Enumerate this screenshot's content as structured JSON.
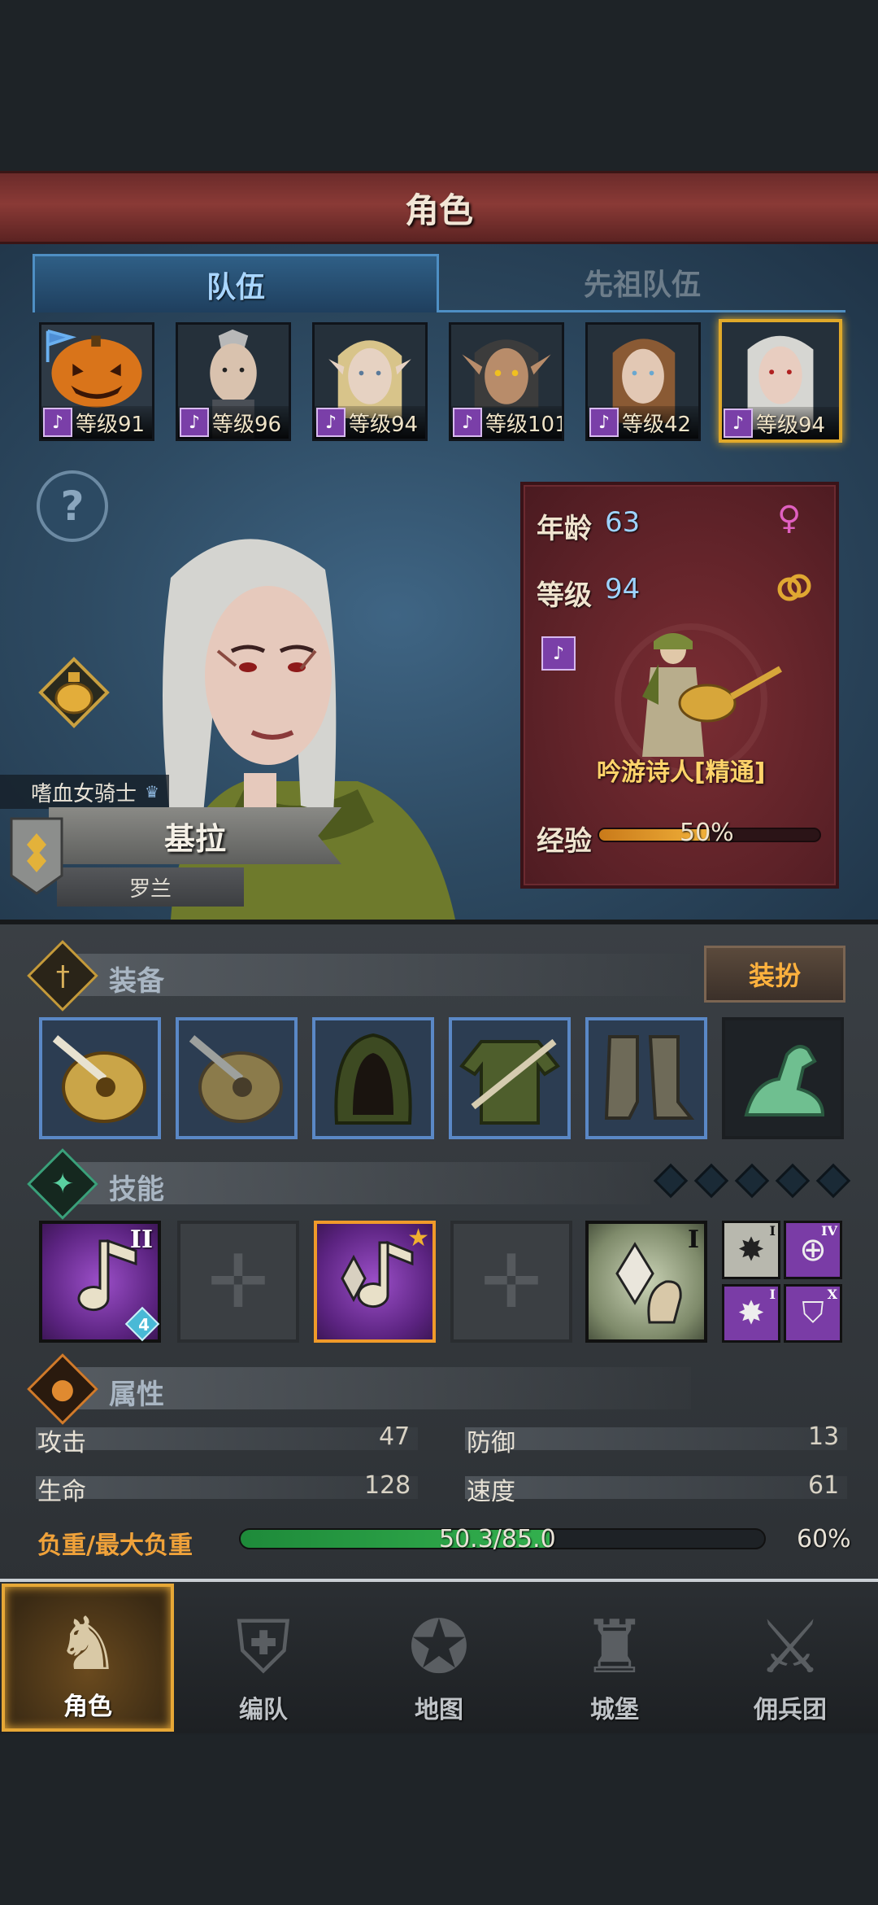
{
  "header": {
    "title": "角色"
  },
  "tabs": [
    {
      "label": "队伍",
      "active": true
    },
    {
      "label": "先祖队伍",
      "active": false
    }
  ],
  "party": [
    {
      "level": "等级91",
      "portrait": "pumpkin-head-icon"
    },
    {
      "level": "等级96",
      "portrait": "warrior-mohawk-icon"
    },
    {
      "level": "等级94",
      "portrait": "blonde-elf-icon"
    },
    {
      "level": "等级101",
      "portrait": "dark-elf-icon"
    },
    {
      "level": "等级42",
      "portrait": "brown-hair-woman-icon"
    },
    {
      "level": "等级94",
      "portrait": "white-hair-elf-icon",
      "selected": true
    }
  ],
  "character": {
    "title": "嗜血女骑士",
    "name": "基拉",
    "origin": "罗兰",
    "age_label": "年龄",
    "age": "63",
    "level_label": "等级",
    "level": "94",
    "class_name": "吟游诗人[精通]",
    "exp_label": "经验",
    "exp_percent": "50%",
    "exp_fraction": 0.5
  },
  "equipment": {
    "section_title": "装备",
    "dress_button": "装扮",
    "slots": [
      "lute-icon",
      "lute-icon",
      "hood-icon",
      "tunic-icon",
      "boots-icon",
      "jade-horse-icon"
    ]
  },
  "skills": {
    "section_title": "技能",
    "items": [
      {
        "icon": "music-note-icon",
        "rank": "II",
        "badge": "4"
      },
      {
        "icon": "empty-slot-icon"
      },
      {
        "icon": "music-crystal-icon",
        "selected": true
      },
      {
        "icon": "empty-slot-icon"
      },
      {
        "icon": "crystal-hand-icon",
        "rank": "I"
      }
    ],
    "mini": [
      {
        "icon": "burst-icon",
        "rank": "I"
      },
      {
        "icon": "target-icon",
        "rank": "IV"
      },
      {
        "icon": "burst-icon",
        "rank": "I"
      },
      {
        "icon": "shield-icon",
        "rank": "X"
      }
    ]
  },
  "attributes": {
    "section_title": "属性",
    "attack_label": "攻击",
    "attack": "47",
    "defense_label": "防御",
    "defense": "13",
    "hp_label": "生命",
    "hp": "128",
    "speed_label": "速度",
    "speed": "61",
    "weight_label": "负重/最大负重",
    "weight": "50.3/85.0",
    "weight_percent": "60%",
    "weight_fraction": 0.59
  },
  "nav": [
    {
      "label": "角色",
      "active": true,
      "icon": "knight-icon"
    },
    {
      "label": "编队",
      "active": false,
      "icon": "helmet-icon"
    },
    {
      "label": "地图",
      "active": false,
      "icon": "compass-map-icon"
    },
    {
      "label": "城堡",
      "active": false,
      "icon": "castle-icon"
    },
    {
      "label": "佣兵团",
      "active": false,
      "icon": "mercenary-icon"
    }
  ]
}
